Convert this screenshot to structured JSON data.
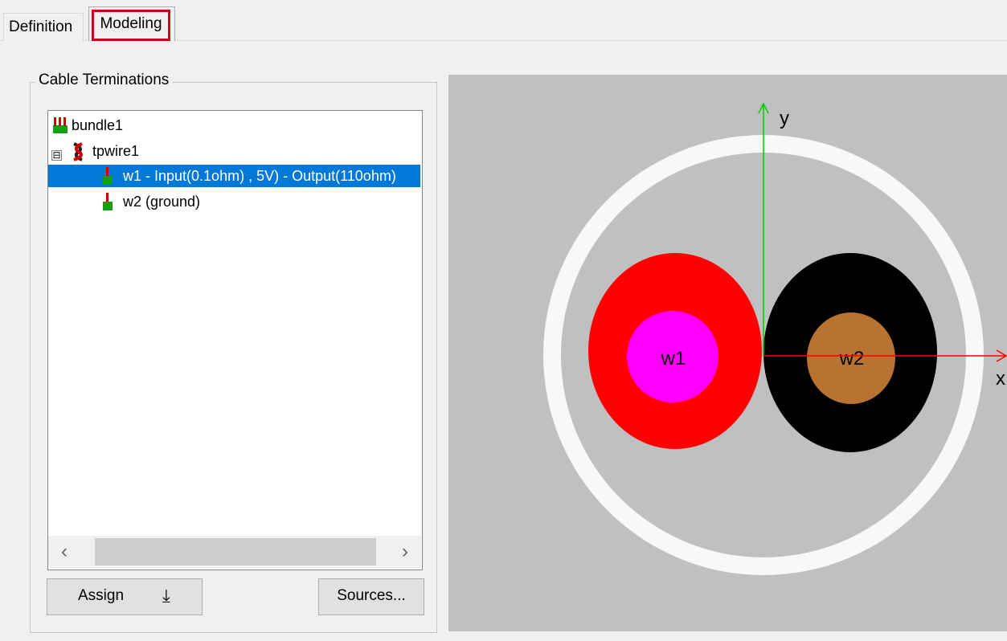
{
  "tabs": [
    {
      "label": "Definition"
    },
    {
      "label": "Modeling"
    }
  ],
  "group": {
    "title": "Cable Terminations"
  },
  "tree": [
    {
      "label": "bundle1"
    },
    {
      "label": "tpwire1",
      "expander": "⊟"
    },
    {
      "label": "w1 - Input(0.1ohm)  , 5V)   - Output(110ohm)"
    },
    {
      "label": "w2 (ground)"
    }
  ],
  "scroll": {
    "left": "‹",
    "right": "›"
  },
  "buttons": {
    "assign": "Assign",
    "assign_icon": "⤓",
    "sources": "Sources..."
  },
  "view": {
    "axis_x": "x",
    "axis_y": "y",
    "wires": [
      {
        "label": "w1",
        "insulation": "#ff0000",
        "conductor": "#ff00ff"
      },
      {
        "label": "w2",
        "insulation": "#000000",
        "conductor": "#b87333"
      }
    ],
    "colors": {
      "background": "#c0c0c0",
      "jacket": "#f8f8f8",
      "x_axis": "#ff0000",
      "y_axis": "#00cc00"
    }
  },
  "icons": {
    "bundle": "bundle-icon",
    "twisted_pair": "twisted-pair-icon",
    "wire": "wire-icon"
  }
}
